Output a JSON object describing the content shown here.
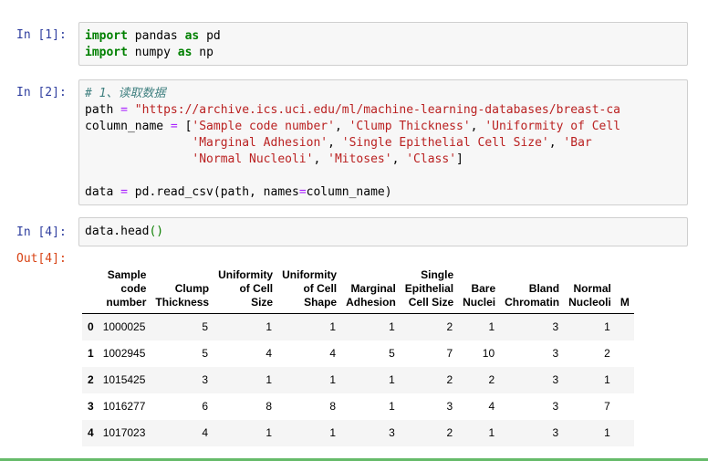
{
  "cells": [
    {
      "prompt": "In [1]:",
      "lines": [
        [
          {
            "t": "import",
            "c": "kw"
          },
          {
            "t": " pandas "
          },
          {
            "t": "as",
            "c": "kw"
          },
          {
            "t": " pd"
          }
        ],
        [
          {
            "t": "import",
            "c": "kw"
          },
          {
            "t": " numpy "
          },
          {
            "t": "as",
            "c": "kw"
          },
          {
            "t": " np"
          }
        ]
      ]
    },
    {
      "prompt": "In [2]:",
      "lines": [
        [
          {
            "t": "# 1、读取数据",
            "c": "cmt"
          }
        ],
        [
          {
            "t": "path "
          },
          {
            "t": "=",
            "c": "op"
          },
          {
            "t": " "
          },
          {
            "t": "\"https://archive.ics.uci.edu/ml/machine-learning-databases/breast-ca",
            "c": "str"
          }
        ],
        [
          {
            "t": "column_name "
          },
          {
            "t": "=",
            "c": "op"
          },
          {
            "t": " ["
          },
          {
            "t": "'Sample code number'",
            "c": "str"
          },
          {
            "t": ", "
          },
          {
            "t": "'Clump Thickness'",
            "c": "str"
          },
          {
            "t": ", "
          },
          {
            "t": "'Uniformity of Cell",
            "c": "str"
          }
        ],
        [
          {
            "t": "               "
          },
          {
            "t": "'Marginal Adhesion'",
            "c": "str"
          },
          {
            "t": ", "
          },
          {
            "t": "'Single Epithelial Cell Size'",
            "c": "str"
          },
          {
            "t": ", "
          },
          {
            "t": "'Bar",
            "c": "str"
          }
        ],
        [
          {
            "t": "               "
          },
          {
            "t": "'Normal Nucleoli'",
            "c": "str"
          },
          {
            "t": ", "
          },
          {
            "t": "'Mitoses'",
            "c": "str"
          },
          {
            "t": ", "
          },
          {
            "t": "'Class'",
            "c": "str"
          },
          {
            "t": "]"
          }
        ],
        [
          {
            "t": ""
          }
        ],
        [
          {
            "t": "data "
          },
          {
            "t": "=",
            "c": "op"
          },
          {
            "t": " pd.read_csv(path, names"
          },
          {
            "t": "=",
            "c": "op"
          },
          {
            "t": "column_name)"
          }
        ]
      ]
    },
    {
      "prompt": "In [4]:",
      "lines": [
        [
          {
            "t": "data.head"
          },
          {
            "t": "()",
            "c": "paren"
          }
        ]
      ]
    }
  ],
  "output_prompt": "Out[4]:",
  "dataframe": {
    "columns": [
      [
        "Sample",
        "code",
        "number"
      ],
      [
        "Clump",
        "Thickness"
      ],
      [
        "Uniformity",
        "of Cell",
        "Size"
      ],
      [
        "Uniformity",
        "of Cell",
        "Shape"
      ],
      [
        "Marginal",
        "Adhesion"
      ],
      [
        "Single",
        "Epithelial",
        "Cell Size"
      ],
      [
        "Bare",
        "Nuclei"
      ],
      [
        "Bland",
        "Chromatin"
      ],
      [
        "Normal",
        "Nucleoli"
      ],
      [
        "M"
      ]
    ],
    "index": [
      "0",
      "1",
      "2",
      "3",
      "4"
    ],
    "rows": [
      [
        "1000025",
        "5",
        "1",
        "1",
        "1",
        "2",
        "1",
        "3",
        "1"
      ],
      [
        "1002945",
        "5",
        "4",
        "4",
        "5",
        "7",
        "10",
        "3",
        "2"
      ],
      [
        "1015425",
        "3",
        "1",
        "1",
        "1",
        "2",
        "2",
        "3",
        "1"
      ],
      [
        "1016277",
        "6",
        "8",
        "8",
        "1",
        "3",
        "4",
        "3",
        "7"
      ],
      [
        "1017023",
        "4",
        "1",
        "1",
        "3",
        "2",
        "1",
        "3",
        "1"
      ]
    ]
  }
}
